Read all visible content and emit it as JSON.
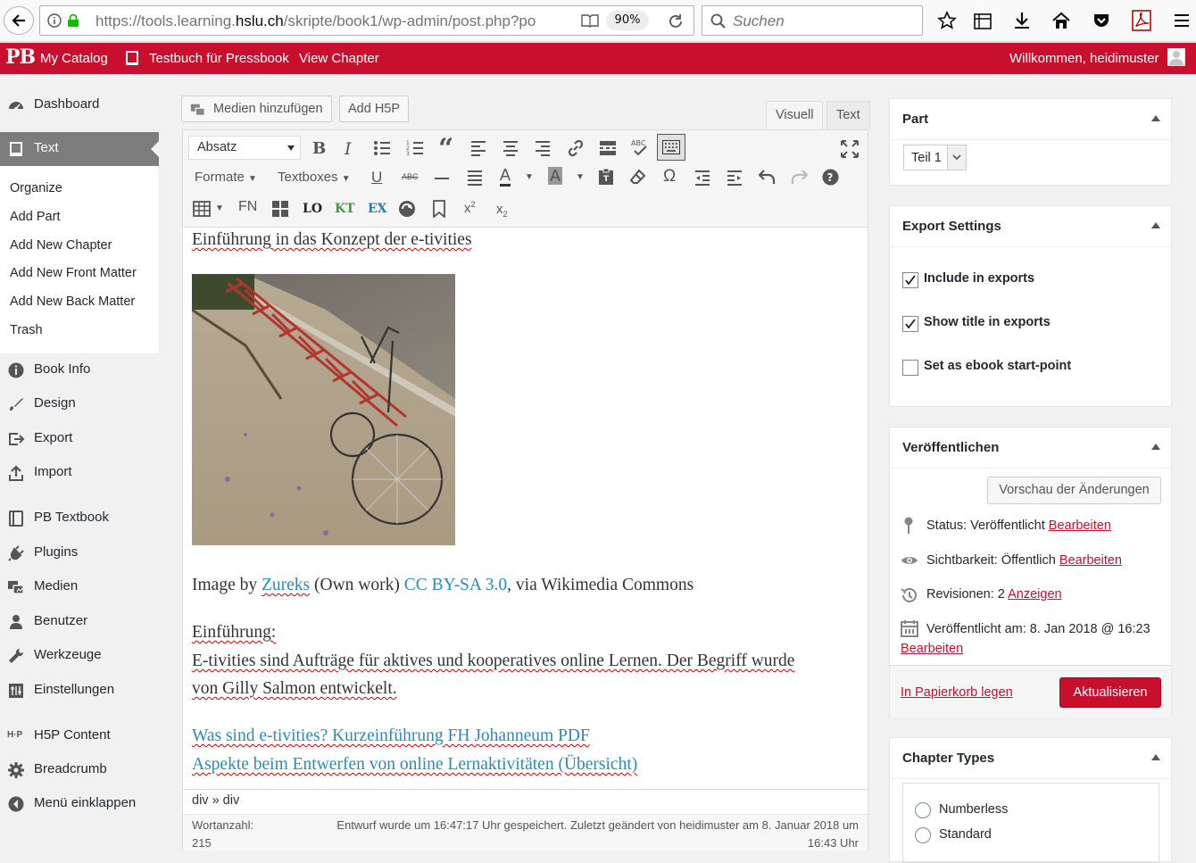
{
  "browser": {
    "url_prefix": "https://tools.learning.",
    "url_host": "hslu.ch",
    "url_suffix": "/skripte/book1/wp-admin/post.php?po",
    "zoom": "90%",
    "search_placeholder": "Suchen"
  },
  "adminbar": {
    "logo": "PB",
    "my_catalog": "My Catalog",
    "book_title": "Testbuch für Pressbook",
    "view_chapter": "View Chapter",
    "welcome": "Willkommen, heidimuster"
  },
  "sidebar": {
    "dashboard": "Dashboard",
    "text": "Text",
    "submenu": [
      "Organize",
      "Add Part",
      "Add New Chapter",
      "Add New Front Matter",
      "Add New Back Matter",
      "Trash"
    ],
    "items": [
      "Book Info",
      "Design",
      "Export",
      "Import",
      "PB Textbook",
      "Plugins",
      "Medien",
      "Benutzer",
      "Werkzeuge",
      "Einstellungen",
      "H5P Content",
      "Breadcrumb",
      "Menü einklappen"
    ]
  },
  "editor": {
    "add_media": "Medien hinzufügen",
    "add_h5p": "Add H5P",
    "tab_visual": "Visuell",
    "tab_text": "Text",
    "format_select": "Absatz",
    "formats": "Formate",
    "textboxes": "Textboxes",
    "fn": "FN",
    "lo": "LO",
    "kt": "KT",
    "ex": "EX",
    "title_line": "Einführung in das Konzept der e-tivities",
    "caption_prefix": "Image by ",
    "caption_link1": "Zureks",
    "caption_mid": " (Own work) ",
    "caption_link2": "CC BY-SA 3.0",
    "caption_suffix": ", via Wikimedia Commons",
    "intro_heading": "Einführung:",
    "intro_line1": "E-tivities sind Aufträge für aktives und kooperatives online Lernen. Der Begriff wurde",
    "intro_line2": "von Gilly Salmon entwickelt.",
    "link1": "Was sind e-tivities? Kurzeinführung FH Johanneum PDF",
    "link2": "Aspekte beim Entwerfen von online Lernaktivitäten (Übersicht)",
    "path": "div » div",
    "wordcount_label": "Wortanzahl:",
    "wordcount": "215",
    "autosave_line1": "Entwurf wurde um 16:47:17 Uhr gespeichert. Zuletzt geändert von heidimuster am 8. Januar 2018 um",
    "autosave_line2": "16:43 Uhr"
  },
  "part_box": {
    "title": "Part",
    "selected": "Teil 1"
  },
  "export_box": {
    "title": "Export Settings",
    "include": "Include in exports",
    "show_title": "Show title in exports",
    "start_point": "Set as ebook start-point",
    "include_checked": true,
    "show_title_checked": true,
    "start_point_checked": false
  },
  "publish_box": {
    "title": "Veröffentlichen",
    "preview": "Vorschau der Änderungen",
    "status_label": "Status: ",
    "status_value": "Veröffentlicht",
    "visibility_label": "Sichtbarkeit: ",
    "visibility_value": "Öffentlich",
    "revisions_label": "Revisionen: ",
    "revisions_value": "2",
    "revisions_link": "Anzeigen",
    "published_label": "Veröffentlicht am: ",
    "published_value": "8. Jan 2018 @ 16:23",
    "edit": "Bearbeiten",
    "trash": "In Papierkorb legen",
    "update": "Aktualisieren"
  },
  "chapter_types": {
    "title": "Chapter Types",
    "options": [
      "Numberless",
      "Standard"
    ]
  },
  "colors": {
    "brand_red": "#c8102e",
    "link_blue": "#2a8bb8",
    "sidebar_active": "#7c7c7c"
  }
}
